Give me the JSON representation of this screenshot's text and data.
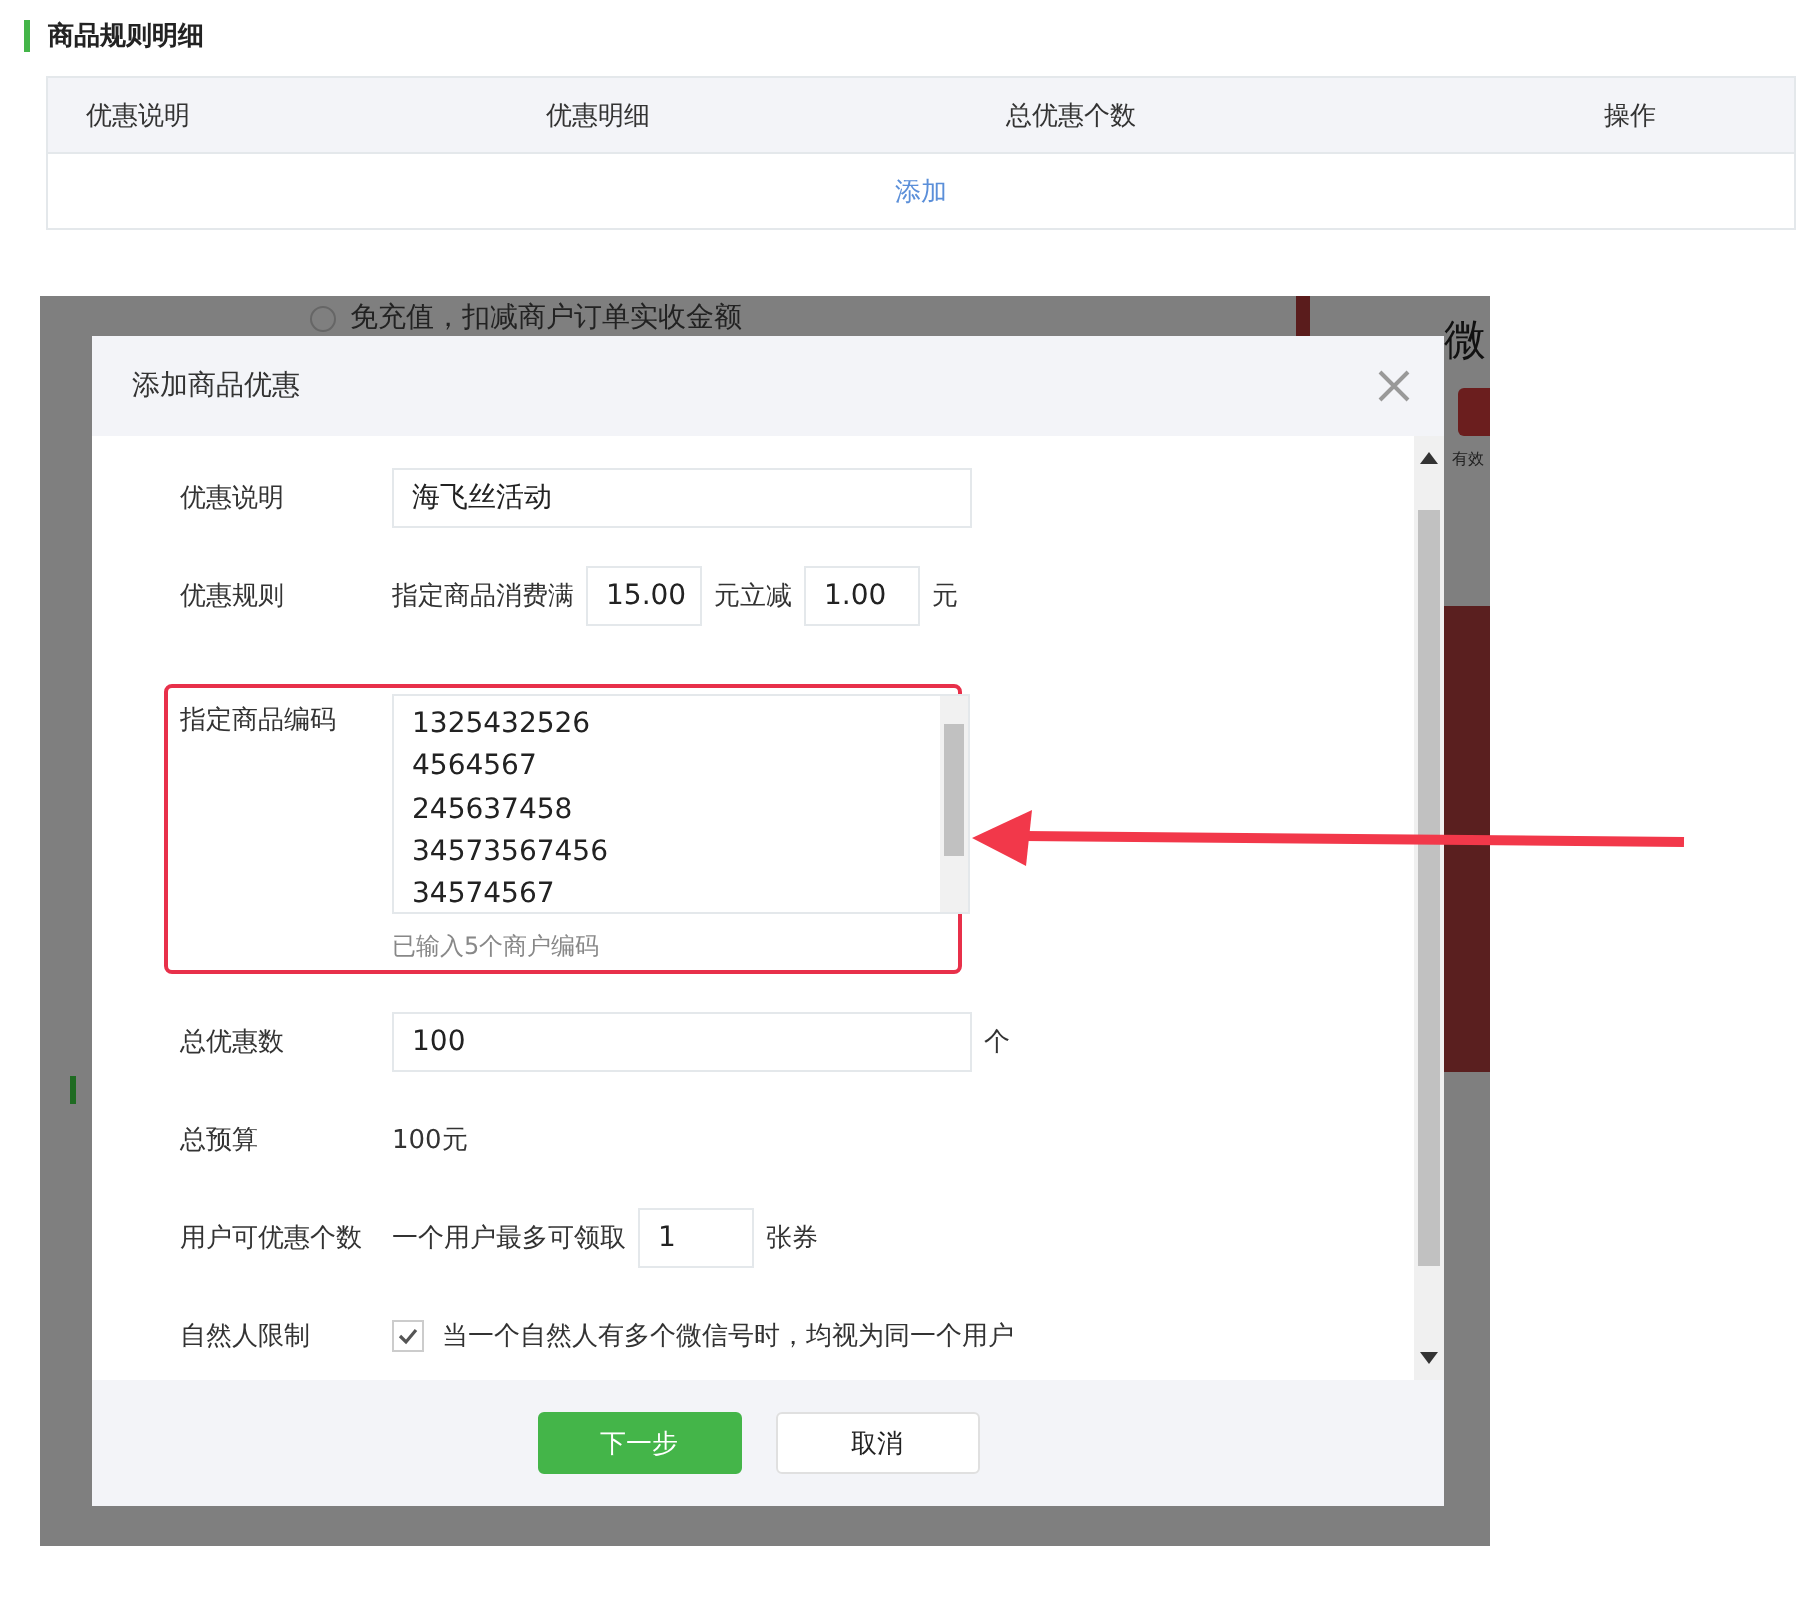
{
  "section": {
    "title": "商品规则明细"
  },
  "table": {
    "columns": [
      "优惠说明",
      "优惠明细",
      "总优惠个数",
      "操作"
    ],
    "add_link": "添加"
  },
  "background": {
    "radio_label": "免充值，扣减商户订单实收金额",
    "radio_selected": false,
    "side_title": "微",
    "side_note": "有效"
  },
  "dialog": {
    "title": "添加商品优惠",
    "fields": [
      {
        "kind": "input",
        "label": "优惠说明",
        "value": "海飞丝活动"
      },
      {
        "kind": "rule",
        "label": "优惠规则",
        "prefix": "指定商品消费满",
        "amount": "15.00",
        "middle": "元立减",
        "discount": "1.00",
        "suffix": "元"
      },
      {
        "kind": "codes",
        "label": "指定商品编码",
        "lines": [
          "1325432526",
          "4564567",
          "245637458",
          "34573567456",
          "34574567"
        ],
        "hint": "已输入5个商户编码",
        "highlighted": true
      },
      {
        "kind": "input",
        "label": "总优惠数",
        "value": "100",
        "unit": "个"
      },
      {
        "kind": "text",
        "label": "总预算",
        "value": "100元"
      },
      {
        "kind": "limit",
        "label": "用户可优惠个数",
        "prefix": "一个用户最多可领取",
        "value": "1",
        "suffix": "张券"
      },
      {
        "kind": "checkbox",
        "label": "自然人限制",
        "checked": true,
        "text": "当一个自然人有多个微信号时，均视为同一个用户"
      }
    ],
    "buttons": [
      {
        "label": "下一步",
        "primary": true
      },
      {
        "label": "取消",
        "primary": false
      }
    ]
  }
}
